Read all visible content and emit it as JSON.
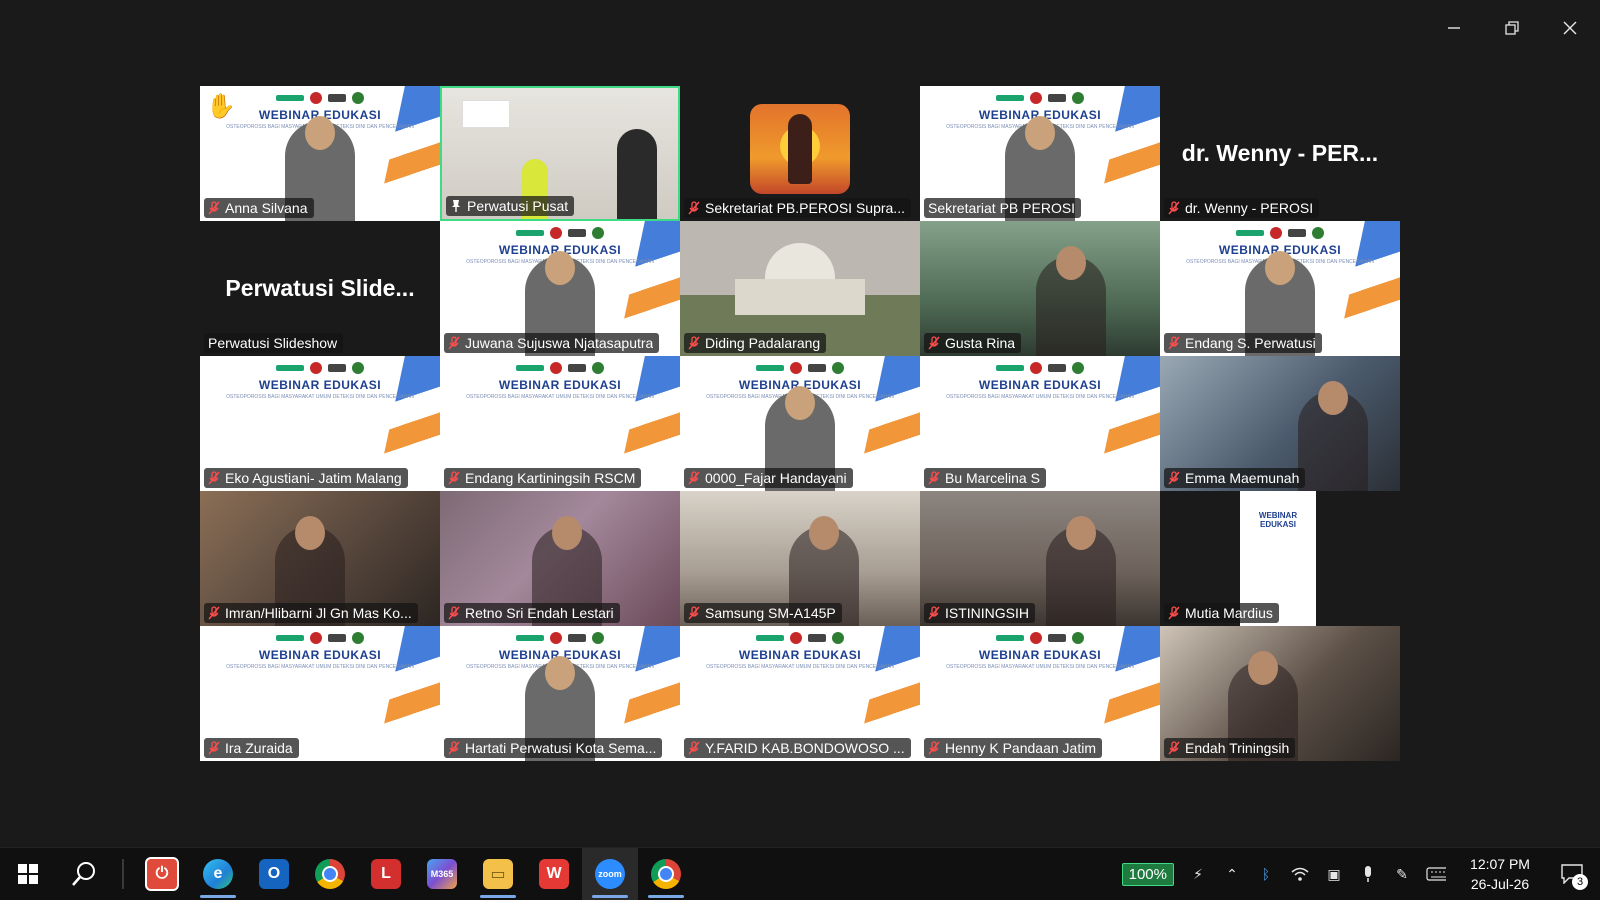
{
  "window": {
    "controls": [
      "minimize-icon",
      "restore-icon",
      "close-icon"
    ]
  },
  "gallery": {
    "tiles": [
      {
        "name": "Anna Silvana",
        "bg": "webinar",
        "raised_hand": true,
        "muted": true
      },
      {
        "name": "Perwatusi Pusat",
        "bg": "studio",
        "pinned": true,
        "active_speaker": true,
        "muted": false
      },
      {
        "name": "Sekretariat PB.PEROSI Supra...",
        "bg": "yoga",
        "muted": true
      },
      {
        "name": "Sekretariat PB PEROSI",
        "bg": "webinar",
        "muted": false
      },
      {
        "name": "dr. Wenny - PEROSI",
        "bg": "dark",
        "big_name": "dr. Wenny - PER...",
        "muted": true
      },
      {
        "name": "Perwatusi Slideshow",
        "bg": "dark",
        "big_name": "Perwatusi Slide...",
        "muted": false
      },
      {
        "name": "Juwana Sujuswa Njatasaputra",
        "bg": "webinar",
        "muted": true
      },
      {
        "name": "Diding Padalarang",
        "bg": "taj",
        "muted": true
      },
      {
        "name": "Gusta Rina",
        "bg": "green",
        "muted": true
      },
      {
        "name": "Endang S. Perwatusi",
        "bg": "webinar",
        "muted": true
      },
      {
        "name": "Eko Agustiani- Jatim Malang",
        "bg": "webinar",
        "muted": true
      },
      {
        "name": "Endang Kartiningsih RSCM",
        "bg": "webinar",
        "muted": true
      },
      {
        "name": "0000_Fajar Handayani",
        "bg": "webinar",
        "muted": true
      },
      {
        "name": "Bu Marcelina S",
        "bg": "webinar",
        "muted": true
      },
      {
        "name": "Emma Maemunah",
        "bg": "blue",
        "muted": true
      },
      {
        "name": "Imran/Hlibarni Jl Gn Mas Ko...",
        "bg": "warm",
        "muted": true
      },
      {
        "name": "Retno Sri Endah Lestari",
        "bg": "purple",
        "muted": true
      },
      {
        "name": "Samsung SM-A145P",
        "bg": "gray",
        "muted": true
      },
      {
        "name": "ISTININGSIH",
        "bg": "room",
        "muted": true
      },
      {
        "name": "Mutia Mardius",
        "bg": "webinar-narrow",
        "muted": true
      },
      {
        "name": "Ira Zuraida",
        "bg": "webinar",
        "muted": true
      },
      {
        "name": "Hartati Perwatusi Kota Sema...",
        "bg": "webinar",
        "muted": true
      },
      {
        "name": "Y.FARID KAB.BONDOWOSO ...",
        "bg": "webinar",
        "muted": true
      },
      {
        "name": "Henny K Pandaan Jatim",
        "bg": "webinar",
        "muted": true
      },
      {
        "name": "Endah Triningsih",
        "bg": "home",
        "muted": true
      }
    ],
    "webinar_title": "WEBINAR EDUKASI",
    "webinar_sub": "OSTEOPOROSIS BAGI MASYARAKAT UMUM DETEKSI DINI DAN PENCEGAHAN"
  },
  "taskbar": {
    "apps": [
      "start-icon",
      "search-icon",
      "app-red-power-icon",
      "edge-icon",
      "outlook-icon",
      "chrome-icon",
      "l-app-icon",
      "m365-icon",
      "file-explorer-icon",
      "wps-icon",
      "zoom-icon",
      "chrome-profile-icon"
    ],
    "battery": "100%",
    "time": "12:07 PM",
    "date": "26-Jul-26",
    "notifications": "3"
  }
}
